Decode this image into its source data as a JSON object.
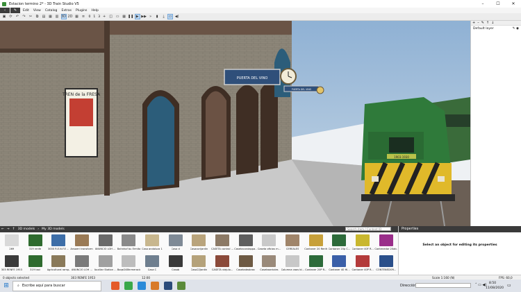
{
  "window": {
    "title": "Estacion termino 2* - 3D Train Studio V5",
    "minimize": "–",
    "maximize": "☐",
    "close": "✕"
  },
  "menu": [
    "Edit",
    "View",
    "Catalog",
    "Extras",
    "Plugins",
    "Help"
  ],
  "toolbar": {
    "view3d": "3D",
    "view2d": "2D",
    "num0": "0",
    "num1": "1",
    "num3": "3"
  },
  "scene": {
    "sign_station": "PUERTA DEL VINO",
    "sign_small": "PUERTA DEL VINO",
    "loco_number": "1903-1930",
    "poster_title": "TREN de la FRESA"
  },
  "layers": {
    "item": "Default layer"
  },
  "library": {
    "breadcrumb_a": "3D models",
    "breadcrumb_b": "My 3D models",
    "search_placeholder": "Search item / Content ID",
    "items": [
      {
        "label": "269",
        "color": "#d9d9d9"
      },
      {
        "label": "319 renfe",
        "color": "#2f6b2f"
      },
      {
        "label": "3000 R.E.N.F.E ...",
        "color": "#3d6ea8"
      },
      {
        "label": "Ansaeri transform...",
        "color": "#9a7a55"
      },
      {
        "label": "ANUNCIO LOH ...",
        "color": "#6a6a6a"
      },
      {
        "label": "Bahnhof bu Ermita",
        "color": "#8a8a8a"
      },
      {
        "label": "Casa andaluza 1",
        "color": "#c8b78e"
      },
      {
        "label": "Casa d",
        "color": "#7f8a96"
      },
      {
        "label": "Casacorijardin",
        "color": "#b9a47c"
      },
      {
        "label": "CASETA control ...",
        "color": "#8c7a66"
      },
      {
        "label": "Casetacondappa...",
        "color": "#5f5f5f"
      },
      {
        "label": "Caseta oficios m...",
        "color": "#c9c9c9"
      },
      {
        "label": "CEREALES",
        "color": "#a0856a"
      },
      {
        "label": "Contaner 20 Renfe",
        "color": "#c7a03a"
      },
      {
        "label": "Contaner 20p C...",
        "color": "#2d6b3a"
      },
      {
        "label": "Contaner 40F R...",
        "color": "#c9b72e"
      },
      {
        "label": "Contenedor 20ab...",
        "color": "#9a2e8a"
      },
      {
        "label": "303 RENFE 1953",
        "color": "#3a3a3a"
      },
      {
        "label": "319 taxi",
        "color": "#2f6b2f"
      },
      {
        "label": "Agricultural ramp...",
        "color": "#8a7a5a"
      },
      {
        "label": "ANUNCIO LOH ...",
        "color": "#7a7a7a"
      },
      {
        "label": "Auxiliar Station ...",
        "color": "#a0a0a0"
      },
      {
        "label": "Boqe24Bhrmeracio",
        "color": "#bdbdbd"
      },
      {
        "label": "Casa C",
        "color": "#6f7f8f"
      },
      {
        "label": "Casab",
        "color": "#3a3a3a"
      },
      {
        "label": "Casa22Jardin",
        "color": "#b5a27a"
      },
      {
        "label": "CASETA viejulo...",
        "color": "#8b4a3a"
      },
      {
        "label": "Casetadeobrac",
        "color": "#6e5a44"
      },
      {
        "label": "Casetaseriales",
        "color": "#9a8a7a"
      },
      {
        "label": "Columna vaos bl...",
        "color": "#c8c8c8"
      },
      {
        "label": "Contaner 20P R...",
        "color": "#2d6b3a"
      },
      {
        "label": "Contaner 40 Hl...",
        "color": "#3a5fa8"
      },
      {
        "label": "Contaner 40P R...",
        "color": "#b33a3a"
      },
      {
        "label": "CONTENEDOR...",
        "color": "#2a4f8a"
      }
    ]
  },
  "properties": {
    "title": "Properties",
    "message": "Select an object for editing its properties"
  },
  "status": {
    "selected": "0 objects selected",
    "item": "303 RENFE 1953",
    "time": "12:00",
    "scale": "Scale 1:160 (N)",
    "fps": "FPS: 60,0"
  },
  "taskbar": {
    "search": "Escribe aquí para buscar",
    "address": "Dirección",
    "time": "8:50",
    "date": "11/08/2020"
  }
}
